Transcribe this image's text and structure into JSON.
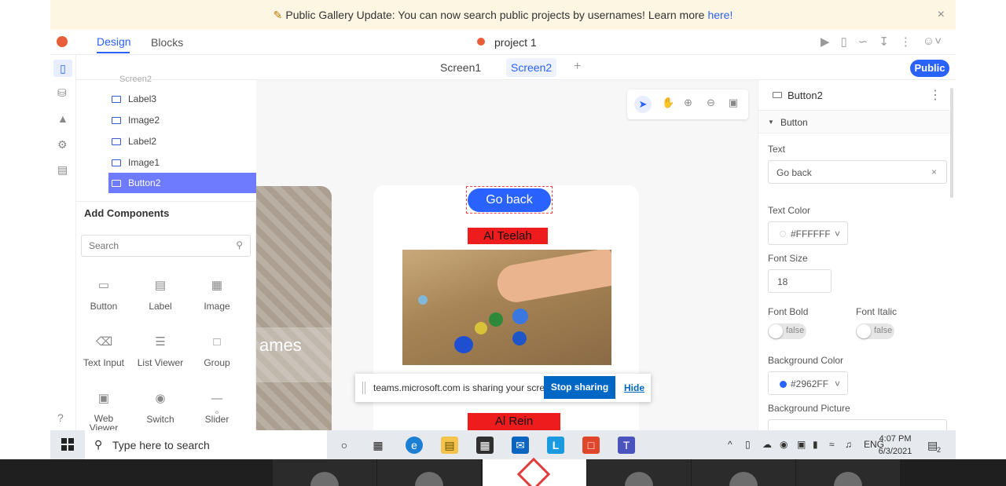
{
  "banner": {
    "text": "Public Gallery Update: You can now search public projects by usernames! Learn more",
    "link": "here!",
    "close": "×"
  },
  "appbar": {
    "tabs": [
      "Design",
      "Blocks"
    ],
    "project_name": "project 1"
  },
  "screens": {
    "tabs": [
      "Screen1",
      "Screen2"
    ],
    "add": "+",
    "public_label": "Public"
  },
  "tree": {
    "cut_label": "Screen2",
    "items": [
      {
        "label": "Label3"
      },
      {
        "label": "Image2"
      },
      {
        "label": "Label2"
      },
      {
        "label": "Image1"
      },
      {
        "label": "Button2",
        "selected": true
      }
    ]
  },
  "components": {
    "title": "Add Components",
    "search_placeholder": "Search",
    "items": [
      {
        "label": "Button",
        "icon": "button-icon"
      },
      {
        "label": "Label",
        "icon": "label-icon"
      },
      {
        "label": "Image",
        "icon": "image-icon"
      },
      {
        "label": "Text Input",
        "icon": "text-input-icon"
      },
      {
        "label": "List Viewer",
        "icon": "list-icon"
      },
      {
        "label": "Group",
        "icon": "group-icon"
      },
      {
        "label": "Web Viewer",
        "icon": "web-viewer-icon"
      },
      {
        "label": "Switch",
        "icon": "switch-icon"
      },
      {
        "label": "Slider",
        "icon": "slider-icon"
      }
    ]
  },
  "canvas": {
    "screen1_text": "ames",
    "button_text": "Go back",
    "label_top": "Al Teelah",
    "label_bottom": "Al Rein"
  },
  "sharing": {
    "text": "teams.microsoft.com is sharing your screen.",
    "stop": "Stop sharing",
    "hide": "Hide"
  },
  "props": {
    "component": "Button2",
    "section": "Button",
    "text_label": "Text",
    "text_value": "Go back",
    "text_clear": "×",
    "text_color_label": "Text Color",
    "text_color_value": "#FFFFFF",
    "font_size_label": "Font Size",
    "font_size_value": "18",
    "font_bold_label": "Font Bold",
    "font_bold_value": "false",
    "font_italic_label": "Font Italic",
    "font_italic_value": "false",
    "bg_color_label": "Background Color",
    "bg_color_value": "#2962FF",
    "bg_picture_label": "Background Picture"
  },
  "taskbar": {
    "search_placeholder": "Type here to search",
    "lang": "ENG",
    "time": "4:07 PM",
    "date": "6/3/2021",
    "notif_count": "2"
  },
  "colors": {
    "accent": "#2962ff",
    "selected_tree": "#6e7bff",
    "label_red": "#ee1c1c"
  }
}
